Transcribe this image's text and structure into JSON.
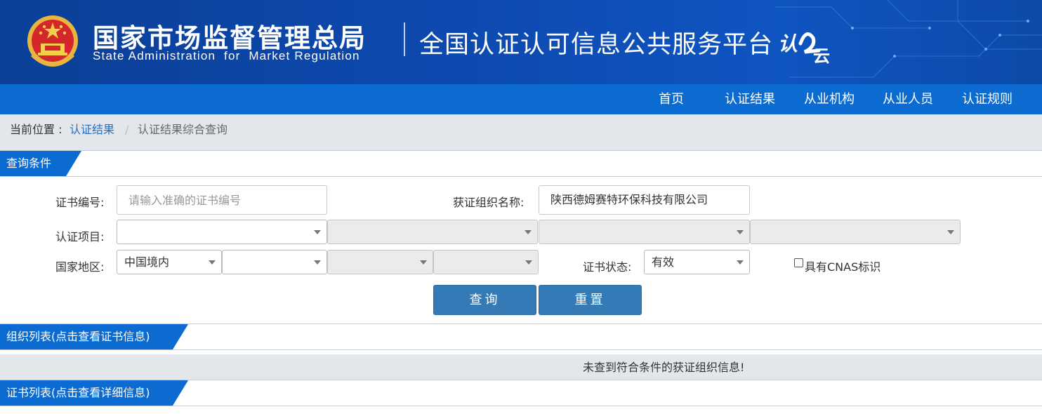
{
  "header": {
    "agency_cn": "国家市场监督管理总局",
    "agency_en": "State Administration  for  Market Regulation",
    "platform_title": "全国认证认可信息公共服务平台",
    "logo_text": "认云"
  },
  "nav": {
    "items": [
      {
        "label": "首页"
      },
      {
        "label": "认证结果"
      },
      {
        "label": "从业机构"
      },
      {
        "label": "从业人员"
      },
      {
        "label": "认证规则"
      }
    ]
  },
  "breadcrumb": {
    "label": "当前位置 :",
    "link": "认证结果",
    "separator": "/",
    "current": "认证结果综合查询"
  },
  "query": {
    "section_title": "查询条件",
    "cert_no_label": "证书编号:",
    "cert_no_placeholder": "请输入准确的证书编号",
    "cert_no_value": "",
    "org_name_label": "获证组织名称:",
    "org_name_value": "陕西德姆赛特环保科技有限公司",
    "project_label": "认证项目:",
    "project_selects": [
      "",
      "",
      "",
      ""
    ],
    "region_label": "国家地区:",
    "region_selects": [
      "中国境内",
      "",
      "",
      ""
    ],
    "status_label": "证书状态:",
    "status_value": "有效",
    "cnas_label": "具有CNAS标识",
    "cnas_checked": false,
    "search_button": "查询",
    "reset_button": "重置"
  },
  "org_list": {
    "section_title": "组织列表(点击查看证书信息)",
    "empty_message": "未查到符合条件的获证组织信息!"
  },
  "cert_list": {
    "section_title": "证书列表(点击查看详细信息)"
  },
  "colors": {
    "banner": "#0d4ab0",
    "nav": "#0b6bd0",
    "button": "#337ab7",
    "link": "#2a6ebb"
  }
}
